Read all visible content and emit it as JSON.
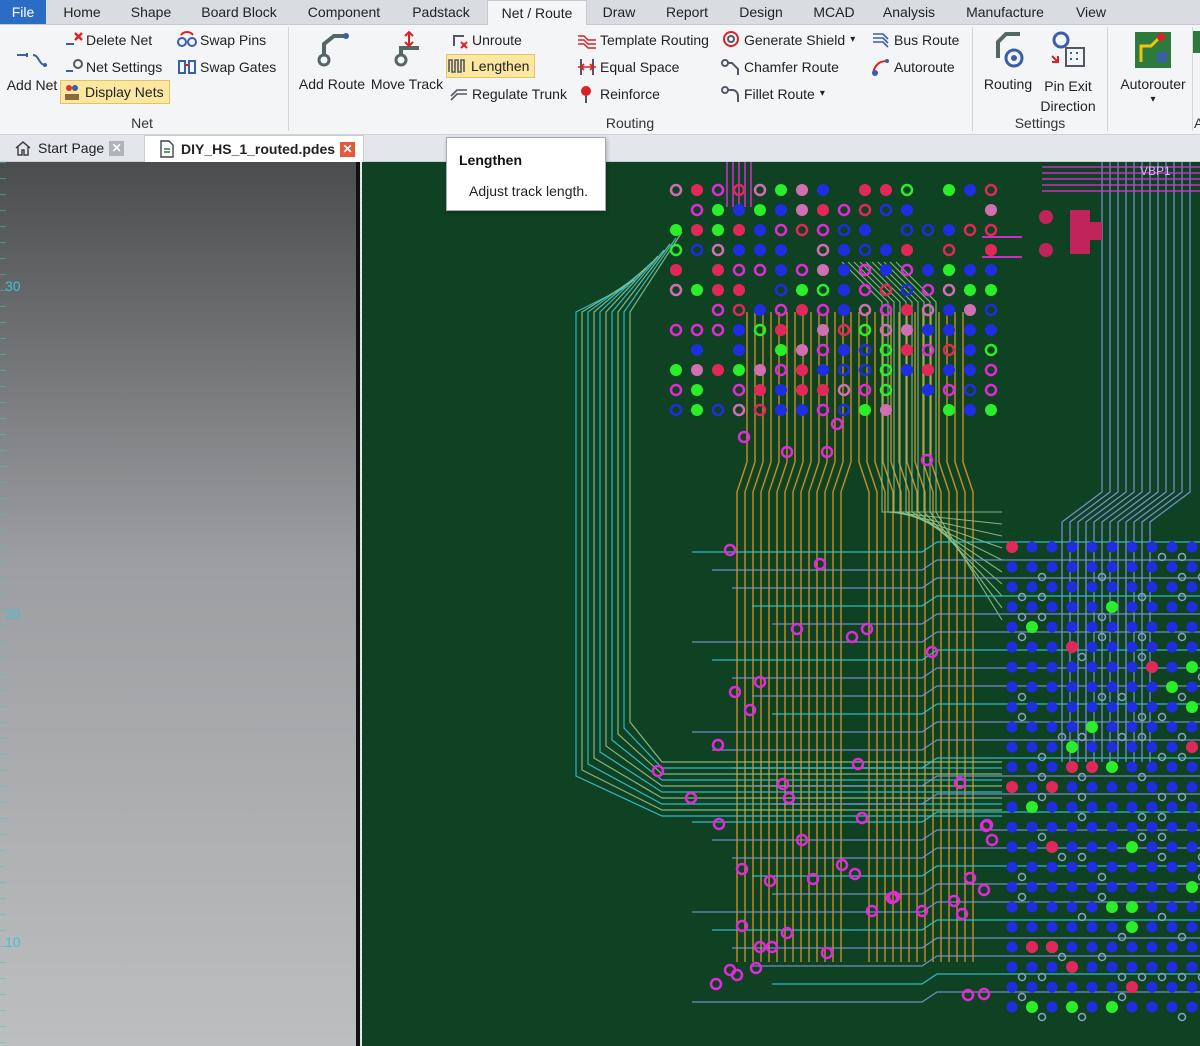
{
  "menu": [
    "File",
    "Home",
    "Shape",
    "Board Block",
    "Component",
    "Padstack",
    "Net / Route",
    "Draw",
    "Report",
    "Design",
    "MCAD",
    "Analysis",
    "Manufacture",
    "View"
  ],
  "active_menu": "Net / Route",
  "ribbon": {
    "net": {
      "label": "Net",
      "add_net": "Add Net",
      "delete_net": "Delete Net",
      "net_settings": "Net Settings",
      "display_nets": "Display Nets",
      "swap_pins": "Swap Pins",
      "swap_gates": "Swap Gates"
    },
    "routing": {
      "label": "Routing",
      "add_route": "Add Route",
      "move_track": "Move Track",
      "unroute": "Unroute",
      "lengthen": "Lengthen",
      "regulate_trunk": "Regulate Trunk",
      "template_routing": "Template Routing",
      "equal_space": "Equal Space",
      "reinforce": "Reinforce",
      "generate_shield": "Generate Shield",
      "chamfer_route": "Chamfer Route",
      "fillet_route": "Fillet Route",
      "bus_route": "Bus Route",
      "autoroute": "Autoroute"
    },
    "settings": {
      "label": "Settings",
      "routing": "Routing",
      "pin_exit_line1": "Pin Exit",
      "pin_exit_line2": "Direction"
    },
    "autorouter": {
      "label": "Autorouter",
      "partial_next_label": "A"
    }
  },
  "tabs": [
    {
      "label": "Start Page",
      "icon": "home-icon"
    },
    {
      "label": "DIY_HS_1_routed.pdes",
      "icon": "document-icon"
    }
  ],
  "tooltip": {
    "title": "Lengthen",
    "body": "Adjust track length."
  },
  "ruler": {
    "ticks": [
      "30",
      "20",
      "10"
    ]
  },
  "board": {
    "net_label": "VBP1"
  },
  "colors": {
    "board_bg": "#0f4222",
    "trace_orange": "#e09522",
    "trace_blue": "#7e95d8",
    "trace_cyan": "#36c4d4",
    "via_magenta": "#e12bd8",
    "pad_blue": "#1f2ee0",
    "pad_green": "#2bee2b",
    "pad_red": "#e2285b",
    "highlight": "#fbe7a0",
    "menu_file": "#2b6cc4"
  }
}
